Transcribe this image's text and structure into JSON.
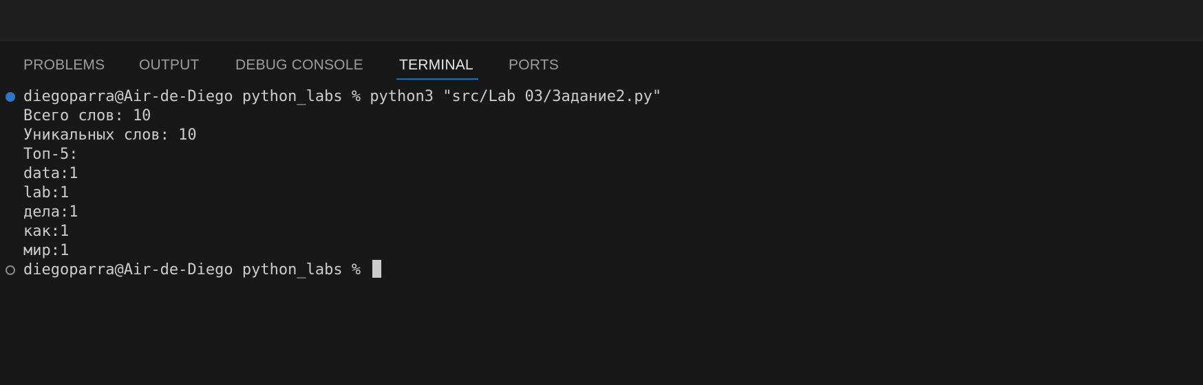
{
  "tabs": [
    {
      "label": "PROBLEMS"
    },
    {
      "label": "OUTPUT"
    },
    {
      "label": "DEBUG CONSOLE"
    },
    {
      "label": "TERMINAL",
      "active": true
    },
    {
      "label": "PORTS"
    }
  ],
  "terminal": {
    "command_line": "diegoparra@Air-de-Diego python_labs % python3 \"src/Lab 03/Задание2.py\"",
    "output": [
      "Всего слов: 10",
      "Уникальных слов: 10",
      "Топ-5:",
      "data:1",
      "lab:1",
      "дела:1",
      "как:1",
      "мир:1"
    ],
    "prompt": "diegoparra@Air-de-Diego python_labs % "
  },
  "colors": {
    "accent": "#0078d4",
    "decoration_success": "#3794ff"
  }
}
